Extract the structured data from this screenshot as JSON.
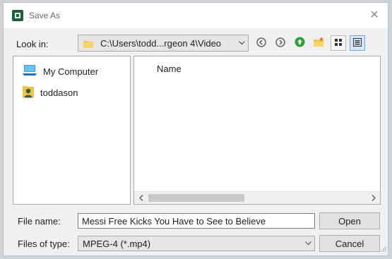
{
  "window": {
    "title": "Save As",
    "close_glyph": "✕"
  },
  "toolbar": {
    "look_in_label": "Look in:",
    "path": "C:\\Users\\todd...rgeon 4\\Video",
    "icons": [
      "back-icon",
      "forward-icon",
      "up-folder-icon",
      "new-folder-icon",
      "list-view-icon",
      "detail-view-icon"
    ]
  },
  "sidebar": {
    "items": [
      {
        "label": "My Computer",
        "icon": "computer-icon"
      },
      {
        "label": "toddason",
        "icon": "user-folder-icon"
      }
    ]
  },
  "filelist": {
    "column_header": "Name"
  },
  "form": {
    "file_name_label": "File name:",
    "file_name_value": "Messi Free Kicks You Have to See to Believe",
    "file_type_label": "Files of type:",
    "file_type_value": "MPEG-4 (*.mp4)"
  },
  "buttons": {
    "open": "Open",
    "cancel": "Cancel"
  },
  "colors": {
    "accent_green": "#2e9e3e",
    "folder_yellow": "#f2c23a",
    "selection_blue": "#d6e6f6"
  }
}
